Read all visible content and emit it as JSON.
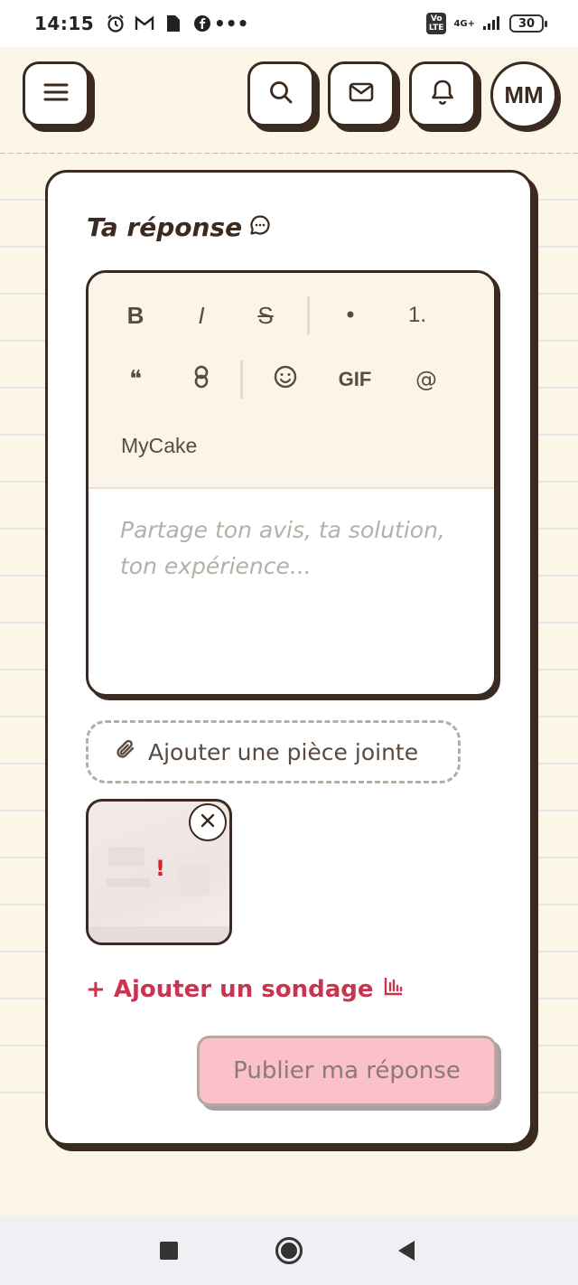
{
  "status_bar": {
    "time": "14:15",
    "network": "4G+",
    "battery": "30",
    "icons": [
      "alarm-icon",
      "gmail-icon",
      "file-icon",
      "facebook-icon",
      "more-icon",
      "volte-icon",
      "signal-icon",
      "battery-icon"
    ]
  },
  "header": {
    "menu_icon": "hamburger-icon",
    "search_icon": "search-icon",
    "mail_icon": "mail-icon",
    "bell_icon": "bell-icon",
    "avatar_initials": "MM"
  },
  "card": {
    "title": "Ta réponse",
    "title_icon": "chat-bubble-icon"
  },
  "editor": {
    "toolbar": {
      "bold": "B",
      "italic": "I",
      "strikethrough": "S",
      "bullet_list": "•",
      "numbered_list": "1.",
      "quote": "❝",
      "link_icon": "link-icon",
      "emoji_icon": "emoji-icon",
      "gif": "GIF",
      "mention": "@",
      "mycake": "MyCake"
    },
    "placeholder": "Partage ton avis, ta solution, ton expérience..."
  },
  "attachment": {
    "button_label": "Ajouter une pièce jointe",
    "button_icon": "paperclip-icon",
    "thumbnail_error": "!"
  },
  "poll": {
    "label": "+ Ajouter un sondage",
    "icon": "bar-chart-icon"
  },
  "publish": {
    "label": "Publier ma réponse"
  },
  "colors": {
    "ink": "#3a2a1f",
    "accent": "#c9344f",
    "publish_bg": "#fbc0c9",
    "page_bg": "#fbf6e8"
  }
}
